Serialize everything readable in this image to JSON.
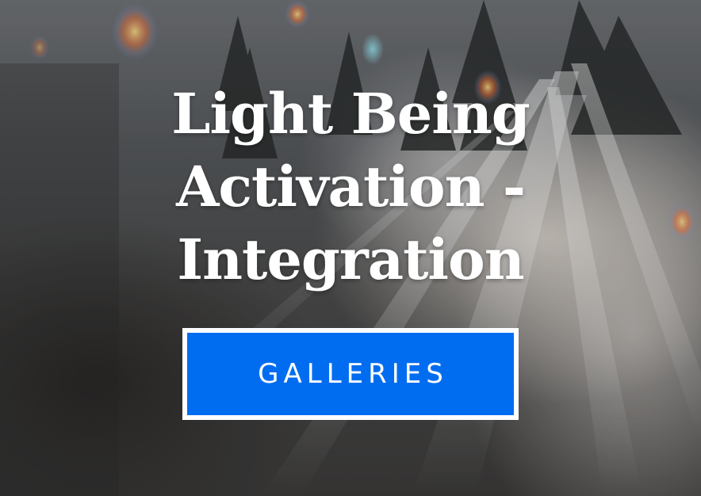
{
  "hero": {
    "title_lines": [
      "Light Being",
      "Activation -",
      "Integration"
    ]
  },
  "cta": {
    "label": "GALLERIES",
    "background": "#006df0",
    "border_color": "#ffffff"
  }
}
